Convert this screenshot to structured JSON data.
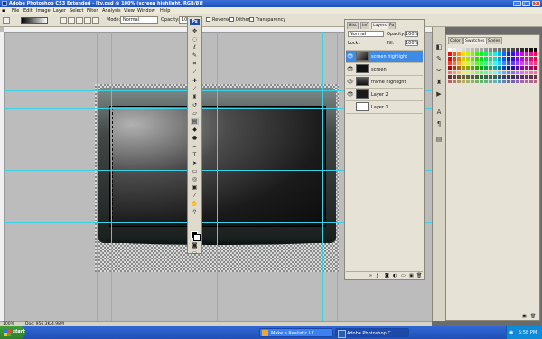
{
  "window": {
    "title": "Adobe Photoshop CS3 Extended - [tv.psd @ 100% (screen highlight, RGB/8)]"
  },
  "menu": [
    "File",
    "Edit",
    "Image",
    "Layer",
    "Select",
    "Filter",
    "Analysis",
    "View",
    "Window",
    "Help"
  ],
  "options": {
    "mode_label": "Mode:",
    "mode_value": "Normal",
    "opacity_label": "Opacity:",
    "opacity_value": "100",
    "reverse": "Reverse",
    "dither": "Dither",
    "transparency": "Transparency"
  },
  "tools": {
    "badge": "Ps"
  },
  "layers_panel": {
    "tabs": [
      "Hist",
      "Inf",
      "Layers",
      "Pa"
    ],
    "blend_mode": "Normal",
    "opacity_label": "Opacity:",
    "opacity_value": "100%",
    "lock_label": "Lock:",
    "fill_label": "Fill:",
    "fill_value": "100%",
    "layers": [
      {
        "name": "screen highlight",
        "selected": true
      },
      {
        "name": "screen",
        "selected": false
      },
      {
        "name": "frame highlight",
        "selected": false
      },
      {
        "name": "Layer 2",
        "selected": false
      },
      {
        "name": "Layer 1",
        "selected": false
      }
    ]
  },
  "swatches_panel": {
    "tabs": [
      "Color",
      "Swatches",
      "Styles"
    ]
  },
  "status": {
    "zoom": "100%",
    "doc": "Doc: 956.3K/4.98M"
  },
  "taskbar": {
    "start": "start",
    "items": [
      {
        "label": "Make a Realistic LC...",
        "active": false
      },
      {
        "label": "Adobe Photoshop C...",
        "active": true
      }
    ],
    "clock": "5:58 PM"
  }
}
